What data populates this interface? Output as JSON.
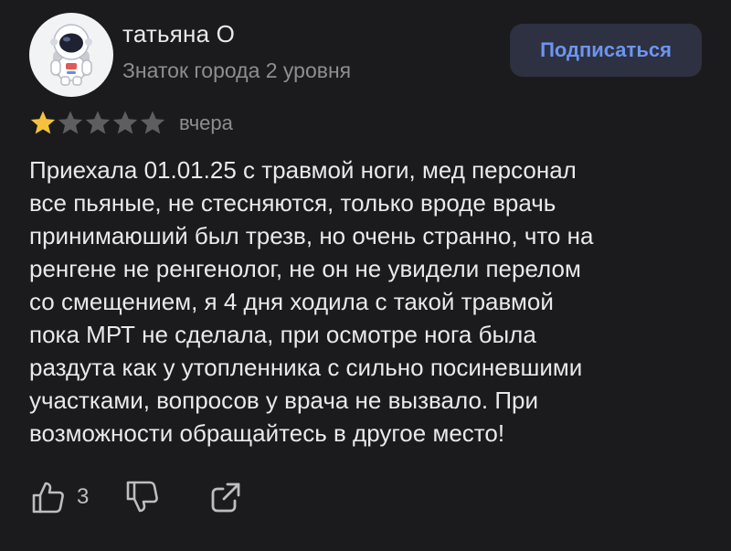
{
  "user": {
    "name": "татьяна О",
    "level": "Знаток города 2 уровня"
  },
  "subscribe_label": "Подписаться",
  "review": {
    "rating": 1,
    "rating_max": 5,
    "date": "вчера",
    "text": "Приехала 01.01.25 с травмой ноги, мед персонал\nвсе  пьяные, не стесняются, только вроде  врачь\nпринимаюший был трезв, но очень странно, что на\nренгене не ренгенолог, не он не увидели перелом\nсо смещением, я 4 дня ходила с такой травмой\nпока МРТ не сделала, при осмотре нога была\nраздута как у утопленника с сильно посиневшими\nучастками, вопросов у врача не вызвало. При\nвозможности обращайтесь в другое место!"
  },
  "actions": {
    "like_count": "3",
    "like_icon": "thumbs-up-icon",
    "dislike_icon": "thumbs-down-icon",
    "share_icon": "share-icon"
  },
  "colors": {
    "background": "#1b1b1d",
    "star_filled": "#f5c33b",
    "star_empty": "#5e5e62",
    "accent": "#6d95ef"
  }
}
